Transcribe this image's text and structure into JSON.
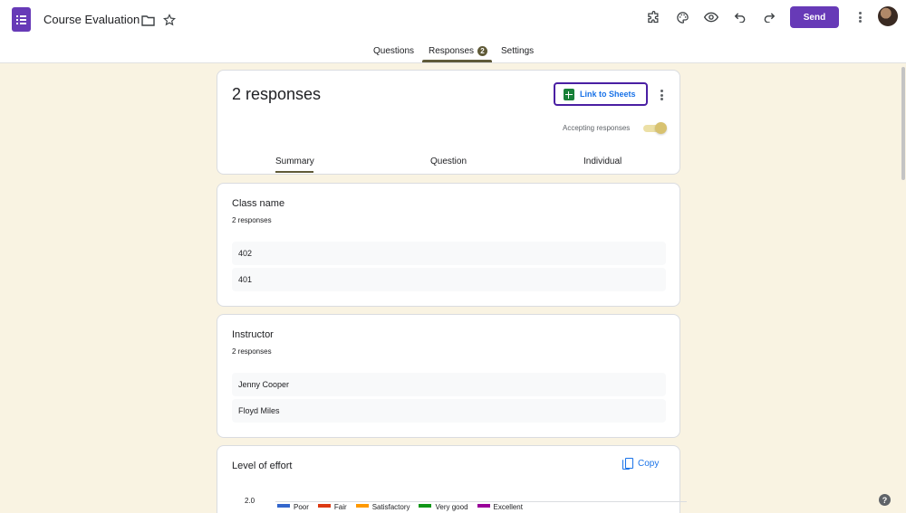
{
  "header": {
    "form_title": "Course Evaluation",
    "send_label": "Send",
    "app_icon": "forms-icon",
    "icons": [
      "folder-icon",
      "star-icon",
      "addon-icon",
      "palette-icon",
      "preview-icon",
      "undo-icon",
      "redo-icon",
      "more-vert-icon"
    ],
    "accent_color": "#673ab7"
  },
  "tabs": {
    "questions": "Questions",
    "responses": "Responses",
    "responses_badge": "2",
    "settings": "Settings",
    "active": "Responses"
  },
  "summary_card": {
    "count_label": "2 responses",
    "link_sheets_label": "Link to Sheets",
    "accepting_label": "Accepting responses",
    "accepting_on": true,
    "subtabs": [
      "Summary",
      "Question",
      "Individual"
    ],
    "active_subtab": "Summary"
  },
  "questions": [
    {
      "title": "Class name",
      "count": "2 responses",
      "answers": [
        "402",
        "401"
      ]
    },
    {
      "title": "Instructor",
      "count": "2 responses",
      "answers": [
        "Jenny Cooper",
        "Floyd Miles"
      ]
    }
  ],
  "effort_card": {
    "title": "Level of effort",
    "copy_label": "Copy",
    "y_tick": "2.0",
    "legend": [
      {
        "label": "Poor",
        "color": "#3366cc"
      },
      {
        "label": "Fair",
        "color": "#dc3912"
      },
      {
        "label": "Satisfactory",
        "color": "#ff9900"
      },
      {
        "label": "Very good",
        "color": "#109618"
      },
      {
        "label": "Excellent",
        "color": "#990099"
      }
    ]
  },
  "help": "?"
}
